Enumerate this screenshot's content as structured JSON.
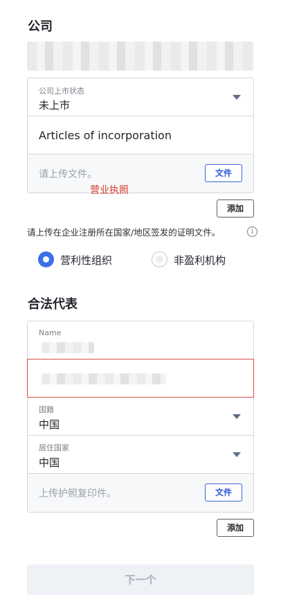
{
  "company": {
    "title": "公司",
    "listing_status": {
      "label": "公司上市状态",
      "value": "未上市"
    },
    "document_name": "Articles of incorporation",
    "upload": {
      "hint": "请上传文件。",
      "file_button": "文件"
    },
    "annotation": "营业执照",
    "add_button": "添加",
    "notice": "请上传在企业注册所在国家/地区签发的证明文件。",
    "info_icon_glyph": "i",
    "org_type": {
      "options": [
        {
          "label": "营利性组织",
          "selected": true
        },
        {
          "label": "非盈利机构",
          "selected": false
        }
      ]
    }
  },
  "legal_rep": {
    "title": "合法代表",
    "name_field": {
      "label": "Name"
    },
    "nationality": {
      "label": "国籍",
      "value": "中国"
    },
    "residence": {
      "label": "居住国家",
      "value": "中国"
    },
    "upload": {
      "hint": "上传护照复印件。",
      "file_button": "文件"
    },
    "add_button": "添加"
  },
  "next_button": "下一个",
  "colors": {
    "accent": "#3c6fe8",
    "error": "#d94a44",
    "annotation": "#d8382d",
    "border": "#d3d6db"
  }
}
